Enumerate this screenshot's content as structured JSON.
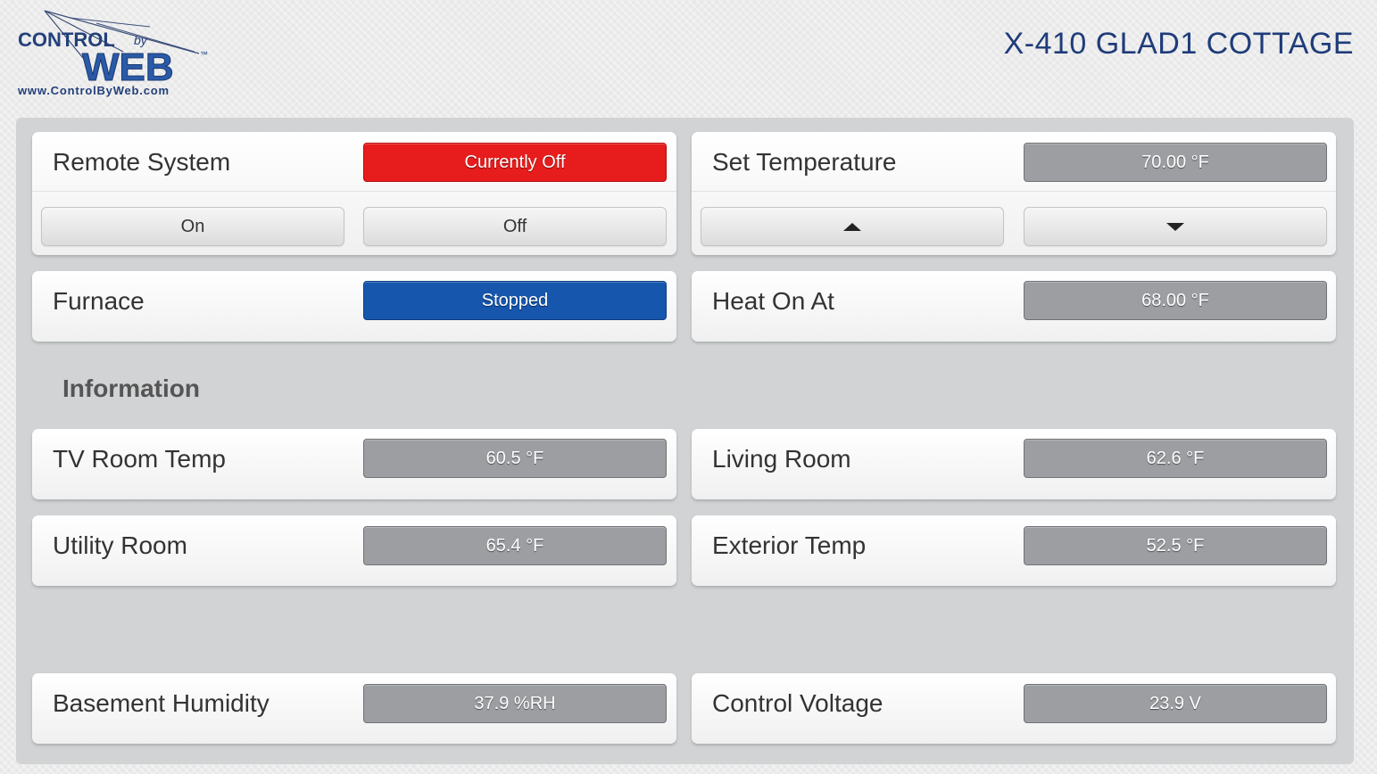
{
  "header": {
    "logo": {
      "line1": "CONTROL",
      "by": "by",
      "line2": "WEB",
      "tm": "™",
      "url": "www.ControlByWeb.com"
    },
    "title": "X-410 GLAD1 COTTAGE"
  },
  "remote_system": {
    "label": "Remote System",
    "status": "Currently Off",
    "on_label": "On",
    "off_label": "Off",
    "status_color": "#e71c1c"
  },
  "set_temperature": {
    "label": "Set Temperature",
    "value": "70.00 °F",
    "up_icon": "triangle-up-icon",
    "down_icon": "triangle-down-icon"
  },
  "furnace": {
    "label": "Furnace",
    "status": "Stopped",
    "status_color": "#1656ad"
  },
  "heat_on_at": {
    "label": "Heat On At",
    "value": "68.00 °F"
  },
  "information": {
    "title": "Information",
    "tv_room": {
      "label": "TV Room Temp",
      "value": "60.5 °F"
    },
    "living_room": {
      "label": "Living Room",
      "value": "62.6 °F"
    },
    "utility_room": {
      "label": "Utility Room",
      "value": "65.4 °F"
    },
    "exterior": {
      "label": "Exterior Temp",
      "value": "52.5 °F"
    }
  },
  "basement_humidity": {
    "label": "Basement Humidity",
    "value": "37.9 %RH"
  },
  "control_voltage": {
    "label": "Control Voltage",
    "value": "23.9 V"
  }
}
